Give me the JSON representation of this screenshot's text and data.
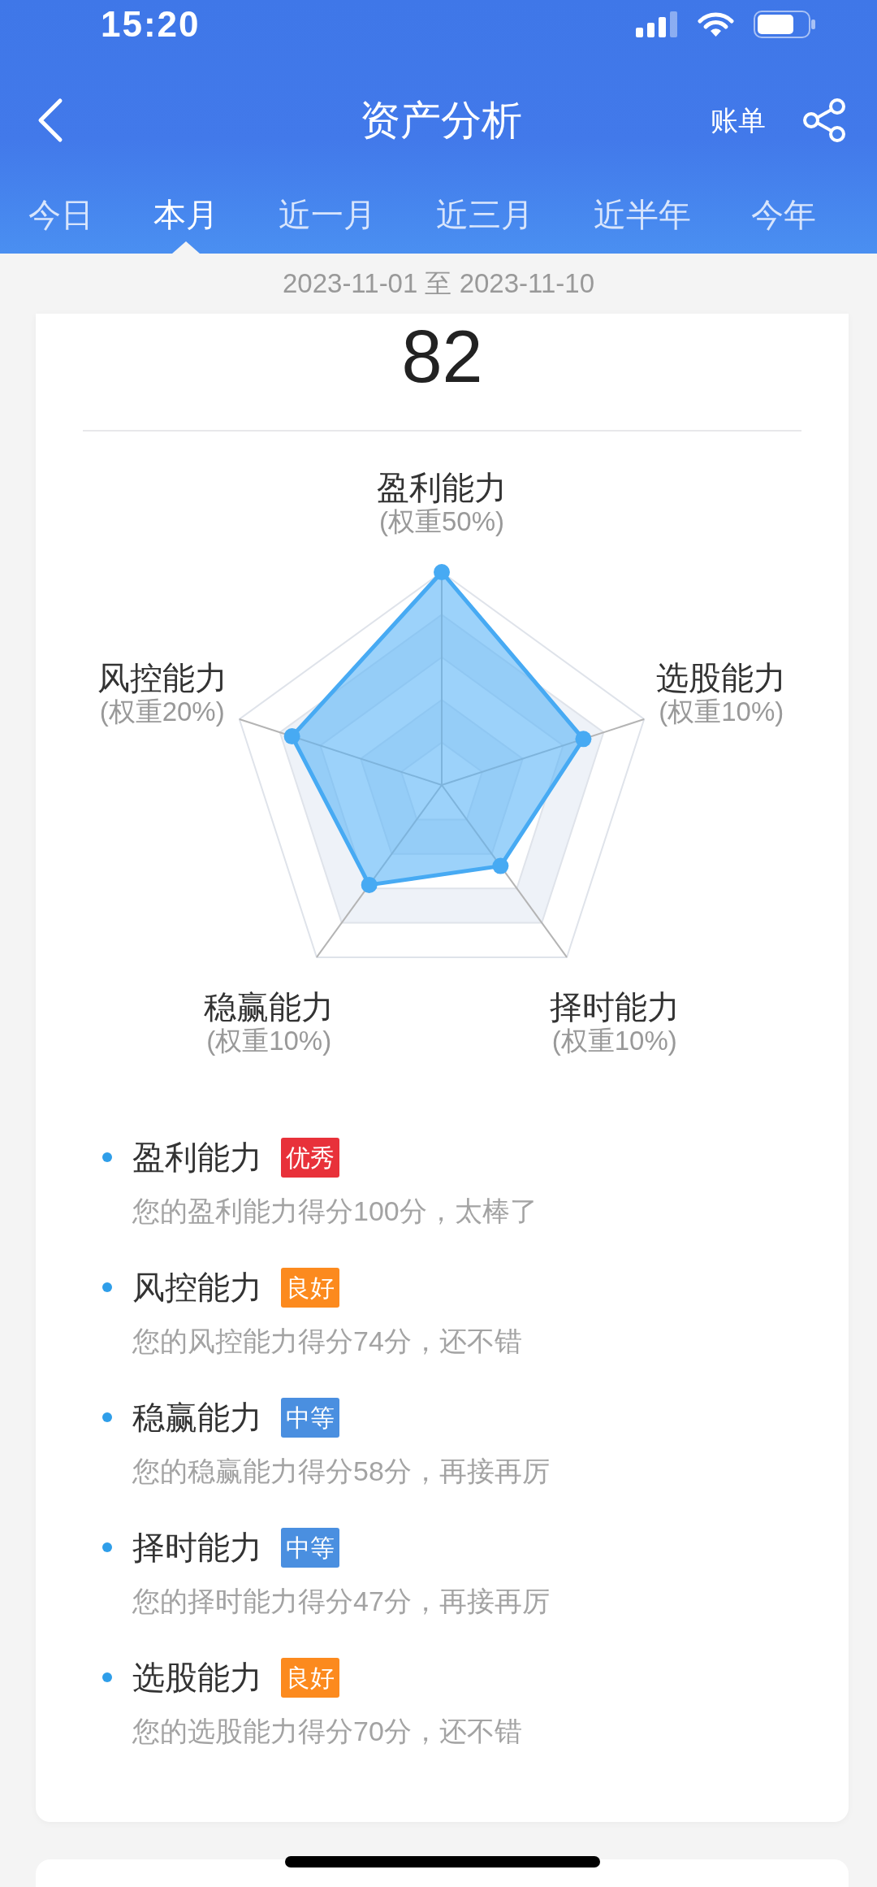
{
  "status_bar": {
    "time": "15:20"
  },
  "nav_bar": {
    "title": "资产分析",
    "action": "账单"
  },
  "tabs": [
    {
      "label": "今日",
      "selected": false
    },
    {
      "label": "本月",
      "selected": true
    },
    {
      "label": "近一月",
      "selected": false
    },
    {
      "label": "近三月",
      "selected": false
    },
    {
      "label": "近半年",
      "selected": false
    },
    {
      "label": "今年",
      "selected": false
    }
  ],
  "date_range": "2023-11-01 至 2023-11-10",
  "score": "82",
  "radar": {
    "axes": [
      {
        "label": "盈利能力",
        "weight": "(权重50%)"
      },
      {
        "label": "风控能力",
        "weight": "(权重20%)"
      },
      {
        "label": "稳赢能力",
        "weight": "(权重10%)"
      },
      {
        "label": "择时能力",
        "weight": "(权重10%)"
      },
      {
        "label": "选股能力",
        "weight": "(权重10%)"
      }
    ]
  },
  "abilities": [
    {
      "name": "盈利能力",
      "badge": {
        "text": "优秀",
        "color": "#e8313a"
      },
      "description": "您的盈利能力得分100分，太棒了"
    },
    {
      "name": "风控能力",
      "badge": {
        "text": "良好",
        "color": "#fc8a1e"
      },
      "description": "您的风控能力得分74分，还不错"
    },
    {
      "name": "稳赢能力",
      "badge": {
        "text": "中等",
        "color": "#4a8fe0"
      },
      "description": "您的稳赢能力得分58分，再接再厉"
    },
    {
      "name": "择时能力",
      "badge": {
        "text": "中等",
        "color": "#4a8fe0"
      },
      "description": "您的择时能力得分47分，再接再厉"
    },
    {
      "name": "选股能力",
      "badge": {
        "text": "良好",
        "color": "#fc8a1e"
      },
      "description": "您的选股能力得分70分，还不错"
    }
  ]
}
